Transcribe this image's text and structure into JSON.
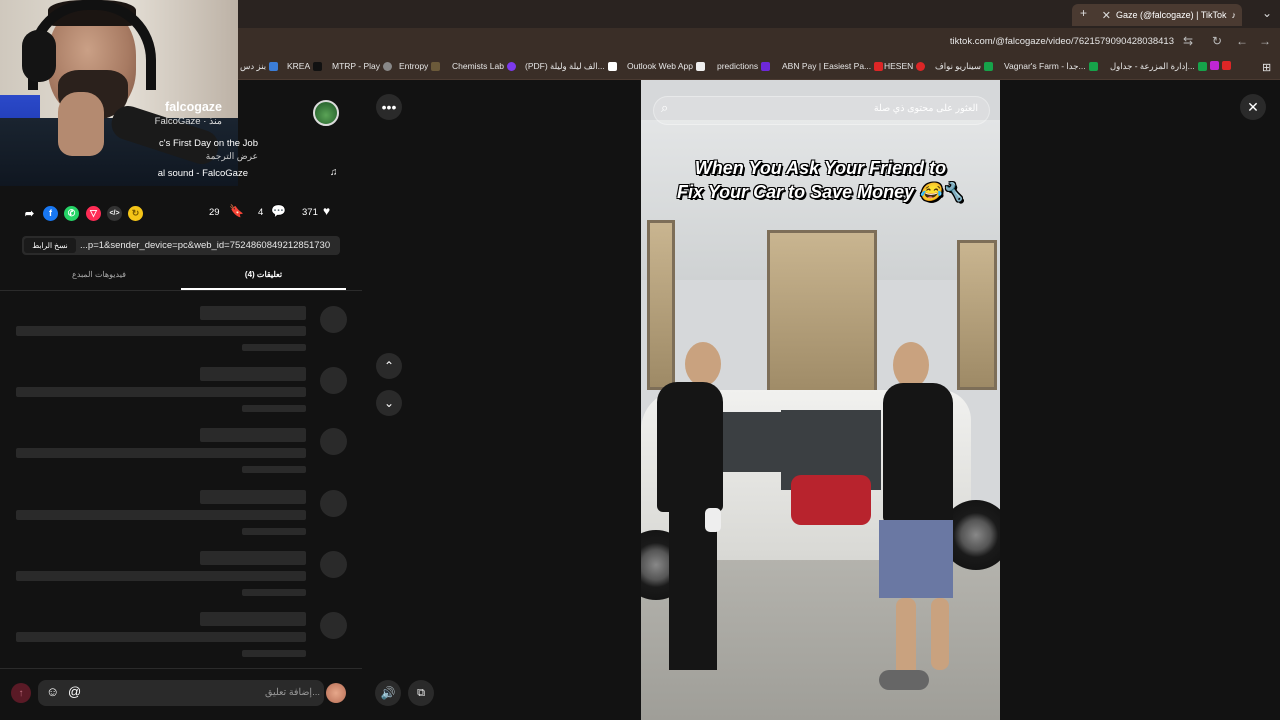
{
  "browser": {
    "tab_title": "Gaze (@falcogaze) | TikTok",
    "url": "tiktok.com/@falcogaze/video/7621579090428038413",
    "new_tab": "+",
    "bookmarks": [
      "بنز دس",
      "KREA",
      "MTRP - Play",
      "Entropy",
      "Chemists Lab",
      "(PDF) الف ليلة وليلة...",
      "Outlook Web App",
      "predictions",
      "ABN Pay | Easiest Pa...",
      "HESEN",
      "سيناريو نواف",
      "Vagnar's Farm - جدا...",
      "إدارة المزرعة - جداول..."
    ]
  },
  "author": {
    "name": "falcogaze",
    "subtitle": "FalcoGaze · منذ",
    "description": "c's First Day on the Job",
    "translate": "عرض الترجمة",
    "music": "al sound - FalcoGaze"
  },
  "stats": {
    "likes": "371",
    "comments": "4",
    "saves": "29"
  },
  "share_link": {
    "url": "...p=1&sender_device=pc&web_id=7524860849212851730",
    "copy_label": "نسخ الرابط"
  },
  "tabs": {
    "comments": "تعليقات (4)",
    "creator_videos": "فيديوهات المبدع"
  },
  "comment_input": {
    "placeholder": "إضافة تعليق..."
  },
  "video": {
    "search_placeholder": "العثور على محتوى ذي صلة",
    "caption_line1": "When You Ask Your Friend to",
    "caption_line2": "Fix Your Car to Save Money 😂🔧"
  },
  "colors": {
    "accent": "#fe2c55",
    "background": "#121212"
  }
}
